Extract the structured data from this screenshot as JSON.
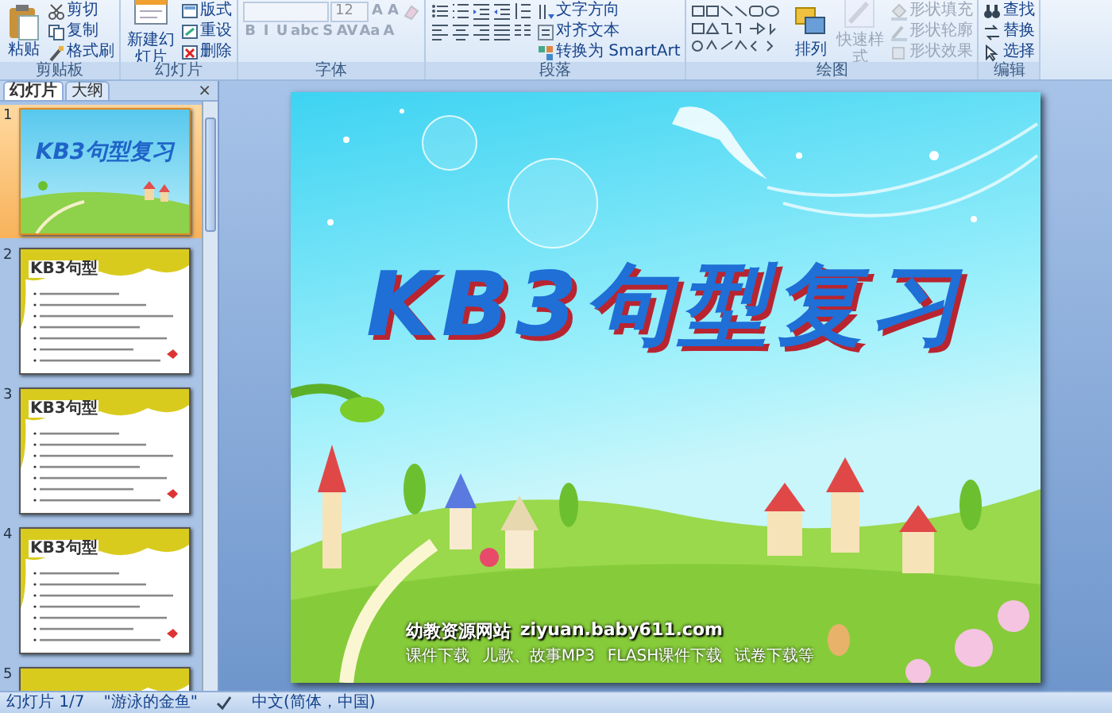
{
  "ribbon": {
    "groups": [
      {
        "label": "剪贴板",
        "columns": [
          [
            [
              {
                "kind": "large",
                "label": "粘贴",
                "disabled": false
              }
            ]
          ],
          [
            [
              {
                "kind": "small",
                "label": "剪切",
                "disabled": false
              }
            ],
            [
              {
                "kind": "small",
                "label": "复制",
                "disabled": false
              }
            ],
            [
              {
                "kind": "small",
                "label": "格式刷",
                "disabled": false
              }
            ]
          ]
        ]
      },
      {
        "label": "幻灯片",
        "columns": [
          [
            [
              {
                "kind": "large",
                "label": "新建幻灯片",
                "disabled": false
              }
            ]
          ],
          [
            [
              {
                "kind": "small",
                "label": "版式",
                "disabled": false
              }
            ],
            [
              {
                "kind": "small",
                "label": "重设",
                "disabled": false
              }
            ],
            [
              {
                "kind": "small",
                "label": "删除",
                "disabled": false
              }
            ]
          ]
        ]
      },
      {
        "label": "字体",
        "columns": [
          [
            [
              {
                "kind": "field",
                "disabled": true
              },
              {
                "kind": "field",
                "value": "12",
                "disabled": true
              },
              {
                "kind": "glyph",
                "label": "A",
                "disabled": true
              },
              {
                "kind": "glyph",
                "label": "A",
                "disabled": true
              },
              {
                "kind": "tool",
                "disabled": true
              }
            ],
            [
              {
                "kind": "glyph",
                "label": "B",
                "disabled": true
              },
              {
                "kind": "glyph",
                "label": "I",
                "disabled": true
              },
              {
                "kind": "glyph",
                "label": "U",
                "disabled": true
              },
              {
                "kind": "glyph",
                "label": "abc",
                "disabled": true
              },
              {
                "kind": "glyph",
                "label": "S",
                "disabled": true
              },
              {
                "kind": "glyph",
                "label": "AV",
                "disabled": true
              },
              {
                "kind": "glyph",
                "label": "Aa",
                "disabled": true
              },
              {
                "kind": "glyph",
                "label": "A",
                "disabled": true
              }
            ]
          ]
        ]
      },
      {
        "label": "段落",
        "columns": [
          [
            [
              {
                "kind": "tool",
                "disabled": false
              },
              {
                "kind": "tool",
                "disabled": false
              },
              {
                "kind": "tool",
                "disabled": false
              },
              {
                "kind": "tool",
                "disabled": false
              },
              {
                "kind": "tool",
                "disabled": false
              }
            ],
            [
              {
                "kind": "tool",
                "disabled": false
              },
              {
                "kind": "tool",
                "disabled": false
              },
              {
                "kind": "tool",
                "disabled": false
              },
              {
                "kind": "tool",
                "disabled": false
              },
              {
                "kind": "tool",
                "disabled": false
              }
            ]
          ],
          [
            [
              {
                "kind": "small",
                "label": "文字方向",
                "disabled": false
              }
            ],
            [
              {
                "kind": "small",
                "label": "对齐文本",
                "disabled": false
              }
            ],
            [
              {
                "kind": "small",
                "label": "转换为 SmartArt",
                "disabled": false
              }
            ]
          ]
        ]
      },
      {
        "label": "绘图",
        "columns": [
          [
            [
              {
                "kind": "tool",
                "disabled": false
              }
            ]
          ],
          [
            [
              {
                "kind": "large",
                "label": "排列",
                "disabled": false
              }
            ]
          ],
          [
            [
              {
                "kind": "large",
                "label": "快速样式",
                "disabled": true
              }
            ]
          ],
          [
            [
              {
                "kind": "small",
                "label": "形状填充",
                "disabled": true
              }
            ],
            [
              {
                "kind": "small",
                "label": "形状轮廓",
                "disabled": true
              }
            ],
            [
              {
                "kind": "small",
                "label": "形状效果",
                "disabled": true
              }
            ]
          ]
        ]
      },
      {
        "label": "编辑",
        "columns": [
          [
            [
              {
                "kind": "small",
                "label": "查找",
                "disabled": false
              }
            ],
            [
              {
                "kind": "small",
                "label": "替换",
                "disabled": false
              }
            ],
            [
              {
                "kind": "small",
                "label": "选择",
                "disabled": false
              }
            ]
          ]
        ]
      }
    ]
  },
  "pane": {
    "tabs": [
      {
        "label": "幻灯片",
        "selected": true
      },
      {
        "label": "大纲",
        "selected": false
      }
    ],
    "close": "×",
    "thumbnails": [
      {
        "number": "1",
        "kind": "title",
        "title": "KB3句型复习",
        "selected": true
      },
      {
        "number": "2",
        "kind": "list",
        "heading": "KB3句型",
        "selected": false
      },
      {
        "number": "3",
        "kind": "list",
        "heading": "KB3句型",
        "selected": false
      },
      {
        "number": "4",
        "kind": "list",
        "heading": "KB3句型",
        "selected": false
      },
      {
        "number": "5",
        "kind": "list",
        "selected": false
      }
    ]
  },
  "slide": {
    "title": "KB3句型复习",
    "site_name": "幼教资源网站",
    "url": "ziyuan.baby611.com",
    "links": [
      "课件下载",
      "儿歌、故事MP3",
      "FLASH课件下载",
      "试卷下载等"
    ]
  },
  "status_bar": {
    "slide_count": "幻灯片 1/7",
    "theme": "\"游泳的金鱼\"",
    "language": "中文(简体，中国)"
  }
}
